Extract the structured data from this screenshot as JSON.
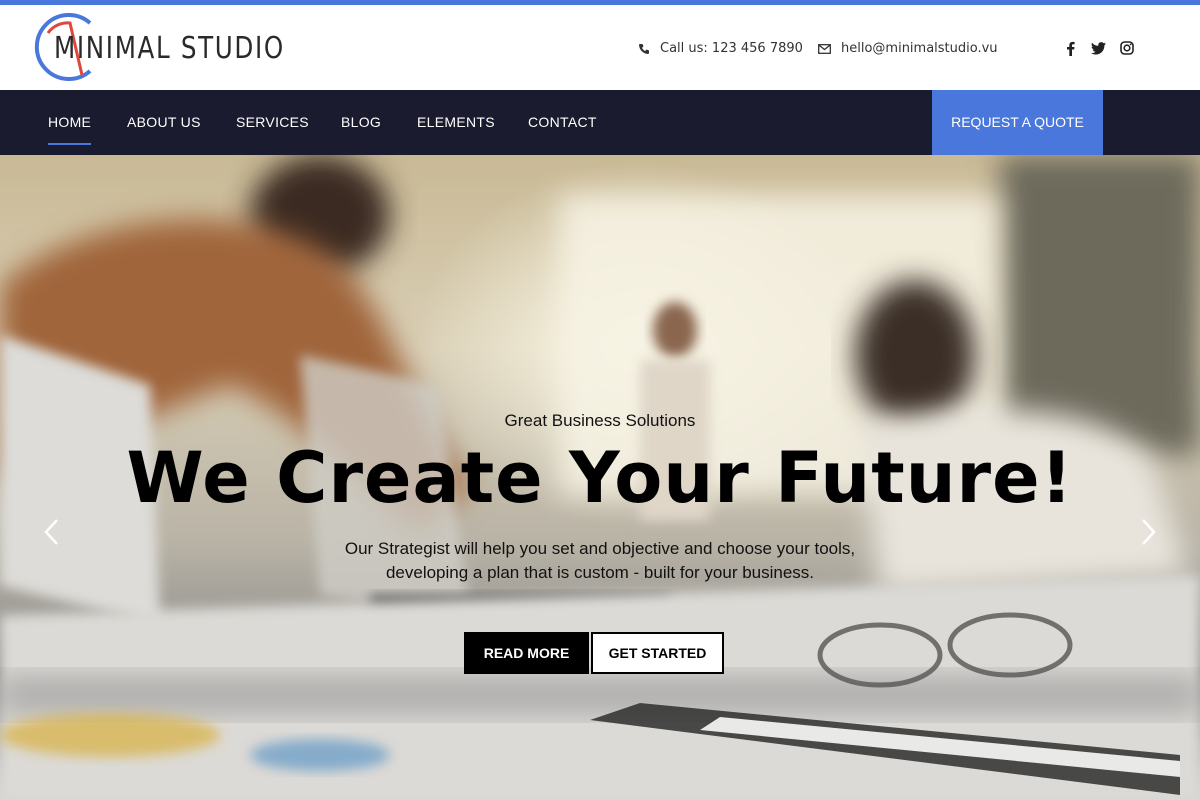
{
  "brand": {
    "logo_text": "MINIMAL STUDIO",
    "accent_color": "#4a77dc",
    "logo_red": "#e0473c",
    "nav_bg": "#1b1b2f"
  },
  "header": {
    "phone_label": "Call us: 123 456 7890",
    "email_label": "hello@minimalstudio.vu",
    "social": [
      "facebook-icon",
      "twitter-icon",
      "instagram-icon"
    ]
  },
  "nav": {
    "items": [
      {
        "label": "HOME",
        "active": true
      },
      {
        "label": "ABOUT US"
      },
      {
        "label": "SERVICES"
      },
      {
        "label": "BLOG"
      },
      {
        "label": "ELEMENTS"
      },
      {
        "label": "CONTACT"
      }
    ],
    "cta": "REQUEST A QUOTE"
  },
  "hero": {
    "subtitle": "Great Business Solutions",
    "title": "We Create Your Future!",
    "description_line1": "Our Strategist will help you set and objective and choose your tools,",
    "description_line2": "developing a plan that is custom - built for your business.",
    "primary_button": "READ MORE",
    "secondary_button": "GET STARTED",
    "prev_icon": "chevron-left-icon",
    "next_icon": "chevron-right-icon"
  }
}
